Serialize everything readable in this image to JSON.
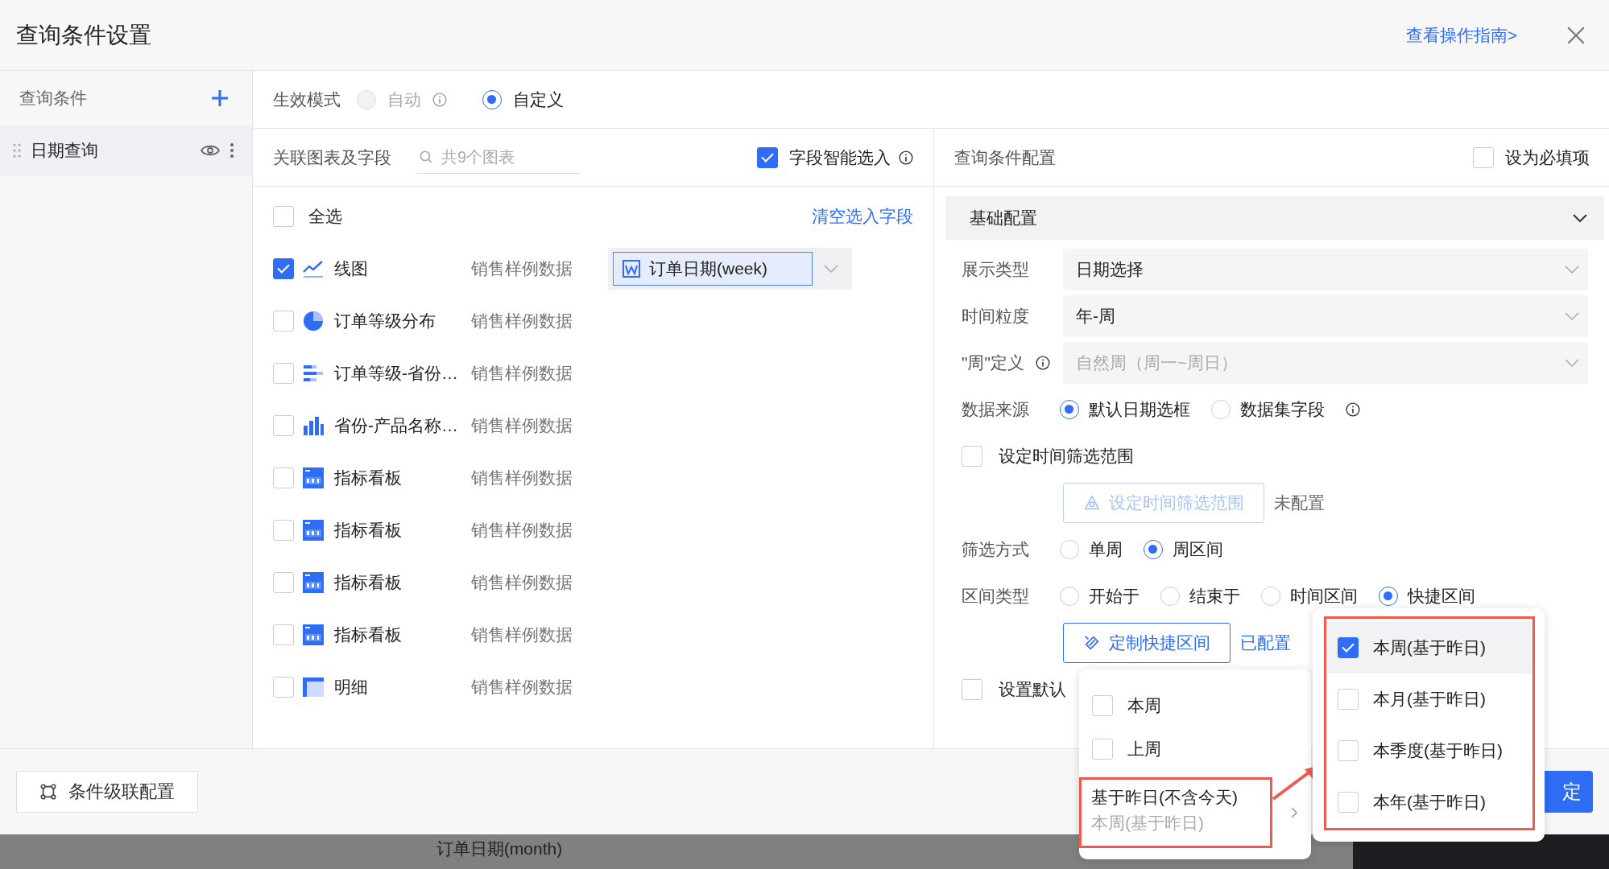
{
  "dialog": {
    "title": "查询条件设置",
    "guide_link": "查看操作指南>"
  },
  "sidebar": {
    "title": "查询条件",
    "items": [
      {
        "label": "日期查询"
      }
    ]
  },
  "mode": {
    "label": "生效模式",
    "options": [
      {
        "label": "自动",
        "selected": false,
        "disabled": true,
        "info": true
      },
      {
        "label": "自定义",
        "selected": true,
        "disabled": false
      }
    ]
  },
  "charts_panel": {
    "title": "关联图表及字段",
    "search": {
      "placeholder": "共9个图表"
    },
    "smart_select": {
      "label": "字段智能选入",
      "checked": true
    },
    "select_all": {
      "label": "全选",
      "checked": false
    },
    "clear_link": "清空选入字段",
    "rows": [
      {
        "kind": "line",
        "name": "线图",
        "dataset": "销售样例数据",
        "checked": true,
        "field": "订单日期(week)"
      },
      {
        "kind": "pie",
        "name": "订单等级分布",
        "dataset": "销售样例数据",
        "checked": false
      },
      {
        "kind": "hbar",
        "name": "订单等级-省份…",
        "dataset": "销售样例数据",
        "checked": false
      },
      {
        "kind": "vbar",
        "name": "省份-产品名称…",
        "dataset": "销售样例数据",
        "checked": false
      },
      {
        "kind": "kpi",
        "name": "指标看板",
        "dataset": "销售样例数据",
        "checked": false
      },
      {
        "kind": "kpi",
        "name": "指标看板",
        "dataset": "销售样例数据",
        "checked": false
      },
      {
        "kind": "kpi",
        "name": "指标看板",
        "dataset": "销售样例数据",
        "checked": false
      },
      {
        "kind": "kpi",
        "name": "指标看板",
        "dataset": "销售样例数据",
        "checked": false
      },
      {
        "kind": "table",
        "name": "明细",
        "dataset": "销售样例数据",
        "checked": false
      }
    ]
  },
  "config_panel": {
    "title": "查询条件配置",
    "required": {
      "label": "设为必填项",
      "checked": false
    },
    "section": {
      "title": "基础配置",
      "expanded": true
    },
    "rows": [
      {
        "kind": "select",
        "label": "展示类型",
        "value": "日期选择",
        "disabled": false
      },
      {
        "kind": "select",
        "label": "时间粒度",
        "value": "年-周",
        "disabled": false
      },
      {
        "kind": "select",
        "label": "\"周\"定义",
        "value": "自然周（周一~周日）",
        "disabled": true,
        "info": true
      },
      {
        "kind": "radio",
        "label": "数据来源",
        "options": [
          {
            "label": "默认日期选框",
            "selected": true
          },
          {
            "label": "数据集字段",
            "selected": false,
            "info": true
          }
        ]
      },
      {
        "kind": "checkbox",
        "label": "设定时间筛选范围",
        "checked": false
      },
      {
        "kind": "button",
        "button": "设定时间筛选范围",
        "disabled": true,
        "status": "未配置"
      },
      {
        "kind": "radio",
        "label": "筛选方式",
        "options": [
          {
            "label": "单周",
            "selected": false
          },
          {
            "label": "周区间",
            "selected": true
          }
        ]
      },
      {
        "kind": "radio",
        "label": "区间类型",
        "options": [
          {
            "label": "开始于",
            "selected": false
          },
          {
            "label": "结束于",
            "selected": false
          },
          {
            "label": "时间区间",
            "selected": false
          },
          {
            "label": "快捷区间",
            "selected": true
          }
        ]
      },
      {
        "kind": "button",
        "button": "定制快捷区间",
        "disabled": false,
        "status": "已配置"
      },
      {
        "kind": "checkbox",
        "label": "设置默认",
        "checked": false
      }
    ]
  },
  "footer": {
    "cascade_button": "条件级联配置",
    "confirm_button": "定"
  },
  "backdrop": {
    "text": "订单日期(month)"
  },
  "quick_menu": {
    "items": [
      {
        "kind": "check",
        "label": "本周",
        "checked": false
      },
      {
        "kind": "check",
        "label": "上周",
        "checked": false
      },
      {
        "kind": "group",
        "label": "基于昨日(不含今天)",
        "summary": "本周(基于昨日)",
        "annotated": true
      }
    ]
  },
  "submenu": {
    "annotated": true,
    "items": [
      {
        "label": "本周(基于昨日)",
        "checked": true,
        "selected": true
      },
      {
        "label": "本月(基于昨日)",
        "checked": false,
        "selected": false
      },
      {
        "label": "本季度(基于昨日)",
        "checked": false,
        "selected": false
      },
      {
        "label": "本年(基于昨日)",
        "checked": false,
        "selected": false
      }
    ]
  }
}
